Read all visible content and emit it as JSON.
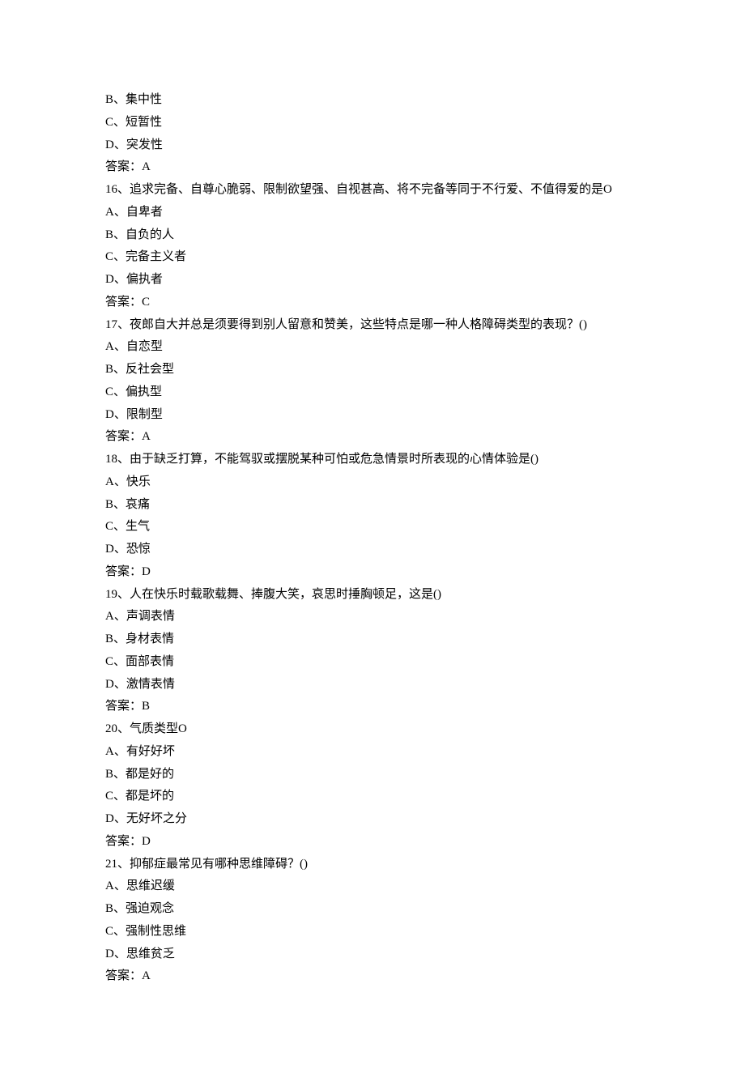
{
  "lines": [
    "B、集中性",
    "C、短暂性",
    "D、突发性",
    "答案：A",
    "16、追求完备、自尊心脆弱、限制欲望强、自视甚高、将不完备等同于不行爱、不值得爱的是O",
    "A、自卑者",
    "B、自负的人",
    "C、完备主义者",
    "D、偏执者",
    "答案：C",
    "17、夜郎自大并总是须要得到别人留意和赞美，这些特点是哪一种人格障碍类型的表现？()",
    "A、自恋型",
    "B、反社会型",
    "C、偏执型",
    "D、限制型",
    "答案：A",
    "18、由于缺乏打算，不能驾驭或摆脱某种可怕或危急情景时所表现的心情体验是()",
    "A、快乐",
    "B、哀痛",
    "C、生气",
    "D、恐惊",
    "答案：D",
    "19、人在快乐时载歌载舞、捧腹大笑，哀思时捶胸顿足，这是()",
    "A、声调表情",
    "B、身材表情",
    "C、面部表情",
    "D、激情表情",
    "答案：B",
    "20、气质类型O",
    "A、有好好坏",
    "B、都是好的",
    "C、都是坏的",
    "D、无好坏之分",
    "答案：D",
    "21、抑郁症最常见有哪种思维障碍？()",
    "A、思维迟缓",
    "B、强迫观念",
    "C、强制性思维",
    "D、思维贫乏",
    "答案：A"
  ]
}
